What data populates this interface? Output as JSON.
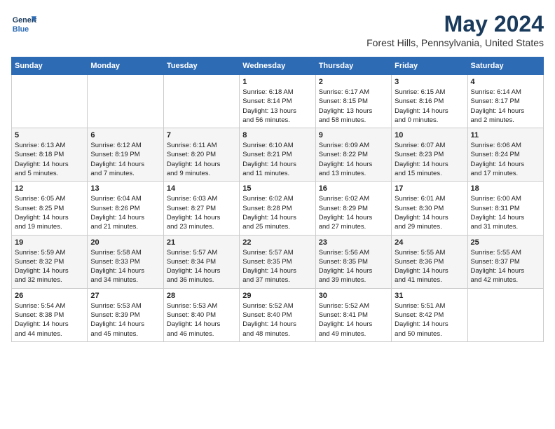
{
  "header": {
    "logo_line1": "General",
    "logo_line2": "Blue",
    "title": "May 2024",
    "subtitle": "Forest Hills, Pennsylvania, United States"
  },
  "columns": [
    "Sunday",
    "Monday",
    "Tuesday",
    "Wednesday",
    "Thursday",
    "Friday",
    "Saturday"
  ],
  "weeks": [
    [
      {
        "day": "",
        "text": ""
      },
      {
        "day": "",
        "text": ""
      },
      {
        "day": "",
        "text": ""
      },
      {
        "day": "1",
        "text": "Sunrise: 6:18 AM\nSunset: 8:14 PM\nDaylight: 13 hours\nand 56 minutes."
      },
      {
        "day": "2",
        "text": "Sunrise: 6:17 AM\nSunset: 8:15 PM\nDaylight: 13 hours\nand 58 minutes."
      },
      {
        "day": "3",
        "text": "Sunrise: 6:15 AM\nSunset: 8:16 PM\nDaylight: 14 hours\nand 0 minutes."
      },
      {
        "day": "4",
        "text": "Sunrise: 6:14 AM\nSunset: 8:17 PM\nDaylight: 14 hours\nand 2 minutes."
      }
    ],
    [
      {
        "day": "5",
        "text": "Sunrise: 6:13 AM\nSunset: 8:18 PM\nDaylight: 14 hours\nand 5 minutes."
      },
      {
        "day": "6",
        "text": "Sunrise: 6:12 AM\nSunset: 8:19 PM\nDaylight: 14 hours\nand 7 minutes."
      },
      {
        "day": "7",
        "text": "Sunrise: 6:11 AM\nSunset: 8:20 PM\nDaylight: 14 hours\nand 9 minutes."
      },
      {
        "day": "8",
        "text": "Sunrise: 6:10 AM\nSunset: 8:21 PM\nDaylight: 14 hours\nand 11 minutes."
      },
      {
        "day": "9",
        "text": "Sunrise: 6:09 AM\nSunset: 8:22 PM\nDaylight: 14 hours\nand 13 minutes."
      },
      {
        "day": "10",
        "text": "Sunrise: 6:07 AM\nSunset: 8:23 PM\nDaylight: 14 hours\nand 15 minutes."
      },
      {
        "day": "11",
        "text": "Sunrise: 6:06 AM\nSunset: 8:24 PM\nDaylight: 14 hours\nand 17 minutes."
      }
    ],
    [
      {
        "day": "12",
        "text": "Sunrise: 6:05 AM\nSunset: 8:25 PM\nDaylight: 14 hours\nand 19 minutes."
      },
      {
        "day": "13",
        "text": "Sunrise: 6:04 AM\nSunset: 8:26 PM\nDaylight: 14 hours\nand 21 minutes."
      },
      {
        "day": "14",
        "text": "Sunrise: 6:03 AM\nSunset: 8:27 PM\nDaylight: 14 hours\nand 23 minutes."
      },
      {
        "day": "15",
        "text": "Sunrise: 6:02 AM\nSunset: 8:28 PM\nDaylight: 14 hours\nand 25 minutes."
      },
      {
        "day": "16",
        "text": "Sunrise: 6:02 AM\nSunset: 8:29 PM\nDaylight: 14 hours\nand 27 minutes."
      },
      {
        "day": "17",
        "text": "Sunrise: 6:01 AM\nSunset: 8:30 PM\nDaylight: 14 hours\nand 29 minutes."
      },
      {
        "day": "18",
        "text": "Sunrise: 6:00 AM\nSunset: 8:31 PM\nDaylight: 14 hours\nand 31 minutes."
      }
    ],
    [
      {
        "day": "19",
        "text": "Sunrise: 5:59 AM\nSunset: 8:32 PM\nDaylight: 14 hours\nand 32 minutes."
      },
      {
        "day": "20",
        "text": "Sunrise: 5:58 AM\nSunset: 8:33 PM\nDaylight: 14 hours\nand 34 minutes."
      },
      {
        "day": "21",
        "text": "Sunrise: 5:57 AM\nSunset: 8:34 PM\nDaylight: 14 hours\nand 36 minutes."
      },
      {
        "day": "22",
        "text": "Sunrise: 5:57 AM\nSunset: 8:35 PM\nDaylight: 14 hours\nand 37 minutes."
      },
      {
        "day": "23",
        "text": "Sunrise: 5:56 AM\nSunset: 8:35 PM\nDaylight: 14 hours\nand 39 minutes."
      },
      {
        "day": "24",
        "text": "Sunrise: 5:55 AM\nSunset: 8:36 PM\nDaylight: 14 hours\nand 41 minutes."
      },
      {
        "day": "25",
        "text": "Sunrise: 5:55 AM\nSunset: 8:37 PM\nDaylight: 14 hours\nand 42 minutes."
      }
    ],
    [
      {
        "day": "26",
        "text": "Sunrise: 5:54 AM\nSunset: 8:38 PM\nDaylight: 14 hours\nand 44 minutes."
      },
      {
        "day": "27",
        "text": "Sunrise: 5:53 AM\nSunset: 8:39 PM\nDaylight: 14 hours\nand 45 minutes."
      },
      {
        "day": "28",
        "text": "Sunrise: 5:53 AM\nSunset: 8:40 PM\nDaylight: 14 hours\nand 46 minutes."
      },
      {
        "day": "29",
        "text": "Sunrise: 5:52 AM\nSunset: 8:40 PM\nDaylight: 14 hours\nand 48 minutes."
      },
      {
        "day": "30",
        "text": "Sunrise: 5:52 AM\nSunset: 8:41 PM\nDaylight: 14 hours\nand 49 minutes."
      },
      {
        "day": "31",
        "text": "Sunrise: 5:51 AM\nSunset: 8:42 PM\nDaylight: 14 hours\nand 50 minutes."
      },
      {
        "day": "",
        "text": ""
      }
    ]
  ]
}
